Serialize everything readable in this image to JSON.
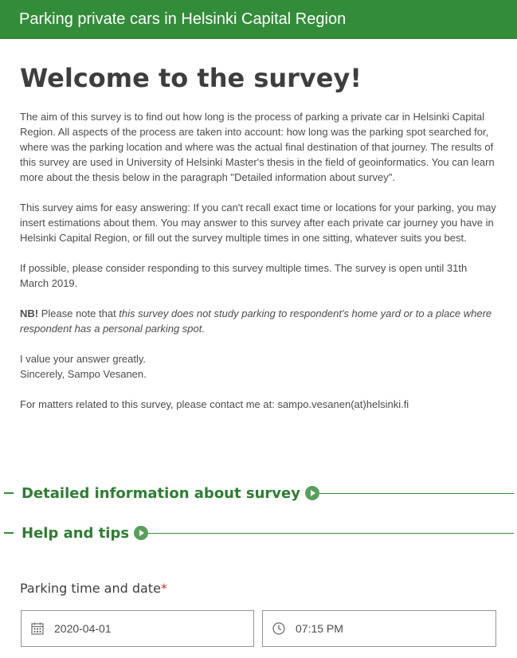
{
  "header": {
    "title": "Parking private cars in Helsinki Capital Region"
  },
  "main": {
    "heading": "Welcome to the survey!",
    "paragraph1": "The aim of this survey is to find out how long is the process of parking a private car in Helsinki Capital Region. All aspects of the process are taken into account: how long was the parking spot searched for, where was the parking location and where was the actual final destination of that journey. The results of this survey are used in University of Helsinki Master's thesis in the field of geoinformatics. You can learn more about the thesis below in the paragraph \"Detailed information about survey\".",
    "paragraph2": "This survey aims for easy answering: If you can't recall exact time or locations for your parking, you may insert estimations about them. You may answer to this survey after each private car journey you have in Helsinki Capital Region, or fill out the survey multiple times in one sitting, whatever suits you best.",
    "paragraph3": "If possible, please consider responding to this survey multiple times. The survey is open until 31th March 2019.",
    "nb_label": "NB!",
    "nb_text": " Please note that ",
    "nb_italic": "this survey does not study parking to respondent's home yard or to a place where respondent has a personal parking spot.",
    "closing_line1": "I value your answer greatly.",
    "closing_line2": "Sincerely, Sampo Vesanen.",
    "contact": "For matters related to this survey, please contact me at: sampo.vesanen(at)helsinki.fi"
  },
  "sections": {
    "detailed": "Detailed information about survey",
    "help": "Help and tips"
  },
  "form": {
    "parking_label": "Parking time and date",
    "required_mark": "*",
    "date_value": "2020-04-01",
    "time_value": "07:15 PM"
  },
  "icons": {
    "date": "calendar-icon",
    "time": "clock-icon",
    "section_toggle": "play-circle-icon"
  },
  "colors": {
    "header_bg": "#338c39",
    "section_title": "#2e7d33",
    "required": "#c0392b"
  }
}
